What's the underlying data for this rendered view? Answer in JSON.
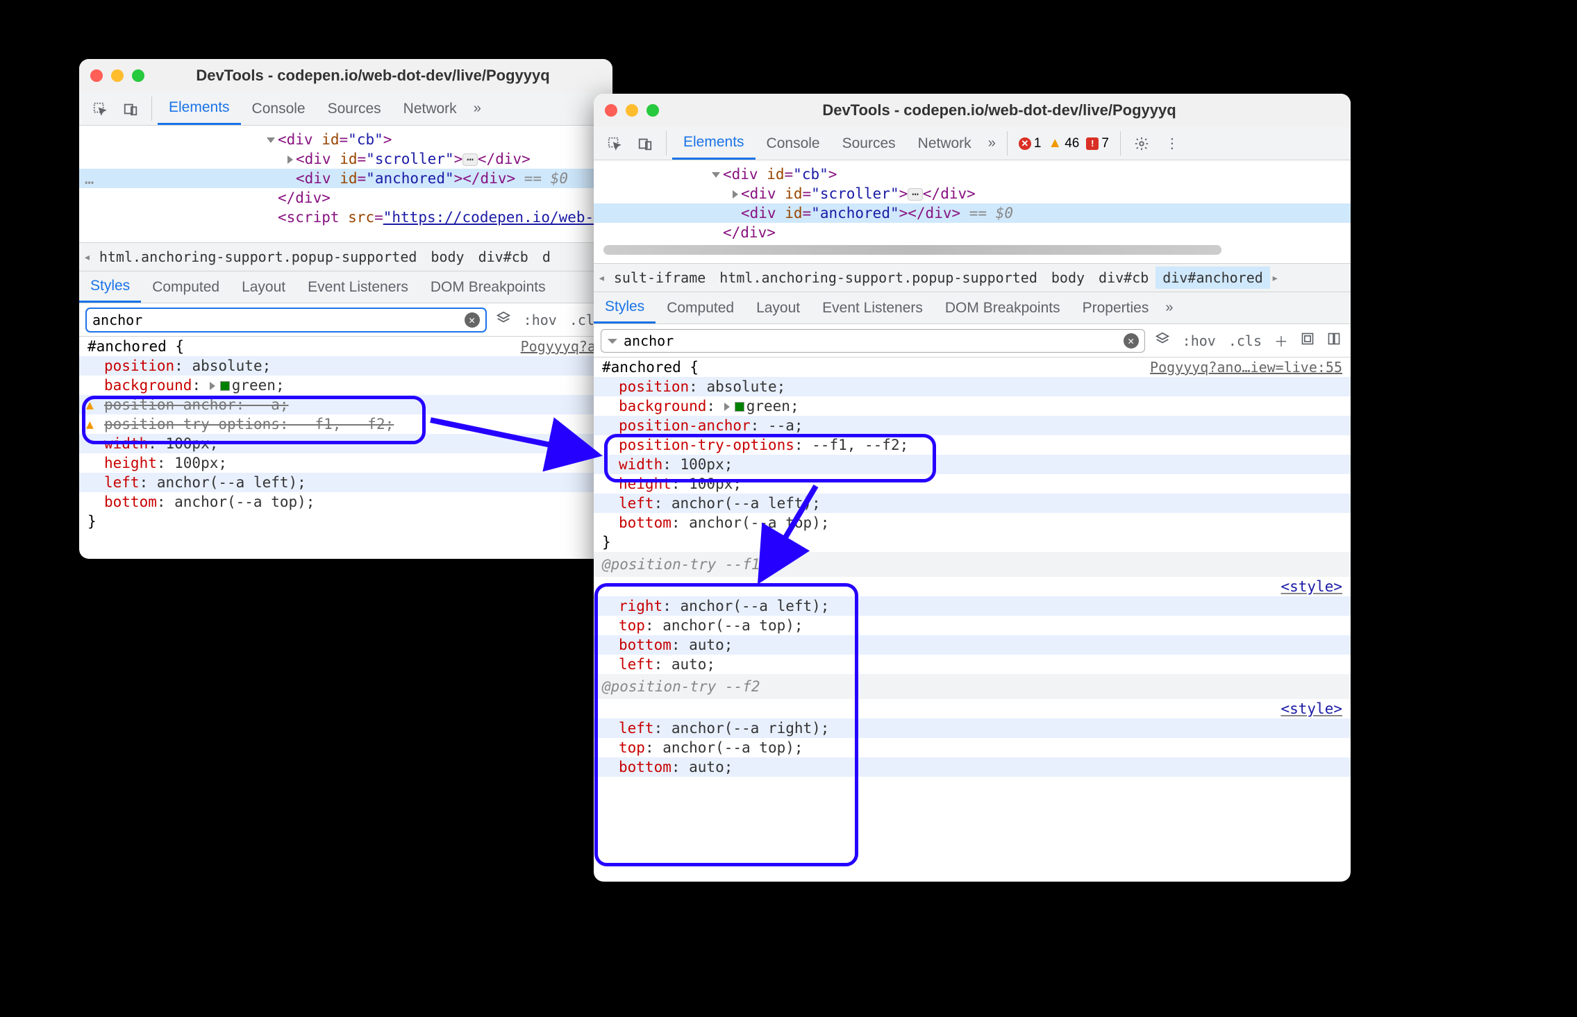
{
  "title": "DevTools - codepen.io/web-dot-dev/live/Pogyyyq",
  "main_tabs": [
    "Elements",
    "Console",
    "Sources",
    "Network"
  ],
  "err_counts": {
    "errors": "1",
    "warnings": "46",
    "issues": "7"
  },
  "style_tabs_left": [
    "Styles",
    "Computed",
    "Layout",
    "Event Listeners",
    "DOM Breakpoints"
  ],
  "style_tabs_right": [
    "Styles",
    "Computed",
    "Layout",
    "Event Listeners",
    "DOM Breakpoints",
    "Properties"
  ],
  "toolbar": {
    "hov": ":hov",
    "cls": ".cls"
  },
  "dom_left": {
    "l1": {
      "open": "<div ",
      "attr": "id",
      "eq": "=",
      "val": "\"cb\"",
      "close": ">"
    },
    "l2": {
      "open": "<div ",
      "attr": "id",
      "eq": "=",
      "val": "\"scroller\"",
      "close": ">",
      "end": "</div>"
    },
    "l3": {
      "open": "<div ",
      "attr": "id",
      "eq": "=",
      "val": "\"anchored\"",
      "close": ">",
      "end": "</div>",
      "eq0": " == $0"
    },
    "l4": "</div>",
    "l5a": "<script ",
    "l5attr": "src",
    "l5eq": "=",
    "l5val": "\"https://codepen.io/web-dot-d"
  },
  "dom_right": {
    "l1": {
      "open": "<div ",
      "attr": "id",
      "eq": "=",
      "val": "\"cb\"",
      "close": ">"
    },
    "l2": {
      "open": "<div ",
      "attr": "id",
      "eq": "=",
      "val": "\"scroller\"",
      "close": ">",
      "end": "</div>"
    },
    "l3": {
      "open": "<div ",
      "attr": "id",
      "eq": "=",
      "val": "\"anchored\"",
      "close": ">",
      "end": "</div>",
      "eq0": " == $0"
    },
    "l4": "</div>"
  },
  "breadcrumb_left": {
    "bc1": "html.anchoring-support.popup-supported",
    "bc2": "body",
    "bc3": "div#cb",
    "bc4": "d"
  },
  "breadcrumb_right": {
    "bc0": "sult-iframe",
    "bc1": "html.anchoring-support.popup-supported",
    "bc2": "body",
    "bc3": "div#cb",
    "bc4": "div#anchored"
  },
  "filter_left": "anchor",
  "filter_right": "anchor",
  "css_left": {
    "selector": "#anchored {",
    "link": "Pogyyyq?an",
    "props": {
      "position": {
        "n": "position",
        "v": ": absolute;"
      },
      "background": {
        "n": "background",
        "v1": ": ",
        "v2": "green;"
      },
      "position_anchor": {
        "n": "position-anchor",
        "v": ": --a;"
      },
      "position_try": {
        "n": "position-try-options",
        "v": ": --f1, --f2;"
      },
      "width": {
        "n": "width",
        "v": ": 100px;"
      },
      "height": {
        "n": "height",
        "v": ": 100px;"
      },
      "left": {
        "n": "left",
        "v": ": anchor(--a left);"
      },
      "bottom": {
        "n": "bottom",
        "v": ": anchor(--a top);"
      }
    },
    "close": "}"
  },
  "css_right": {
    "selector": "#anchored {",
    "link": "Pogyyyq?ano…iew=live:55",
    "props": {
      "position": {
        "n": "position",
        "v": ": absolute;"
      },
      "background": {
        "n": "background",
        "v1": ": ",
        "v2": "green;"
      },
      "position_anchor": {
        "n": "position-anchor",
        "v": ": --a;"
      },
      "position_try": {
        "n": "position-try-options",
        "v": ": --f1, --f2;"
      },
      "width": {
        "n": "width",
        "v": ": 100px;"
      },
      "height": {
        "n": "height",
        "v": ": 100px;"
      },
      "left": {
        "n": "left",
        "v": ": anchor(--a left);"
      },
      "bottom": {
        "n": "bottom",
        "v": ": anchor(--a top);"
      }
    },
    "close": "}",
    "section1_hdr": "@position-try --f1",
    "style_link": "<style>",
    "s1": {
      "right": {
        "n": "right",
        "v": ": anchor(--a left);"
      },
      "top": {
        "n": "top",
        "v": ": anchor(--a top);"
      },
      "bottom": {
        "n": "bottom",
        "v": ": auto;"
      },
      "left": {
        "n": "left",
        "v": ": auto;"
      }
    },
    "section2_hdr": "@position-try --f2",
    "s2": {
      "left": {
        "n": "left",
        "v": ": anchor(--a right);"
      },
      "top": {
        "n": "top",
        "v": ": anchor(--a top);"
      },
      "bottom": {
        "n": "bottom",
        "v": ": auto;"
      }
    }
  }
}
